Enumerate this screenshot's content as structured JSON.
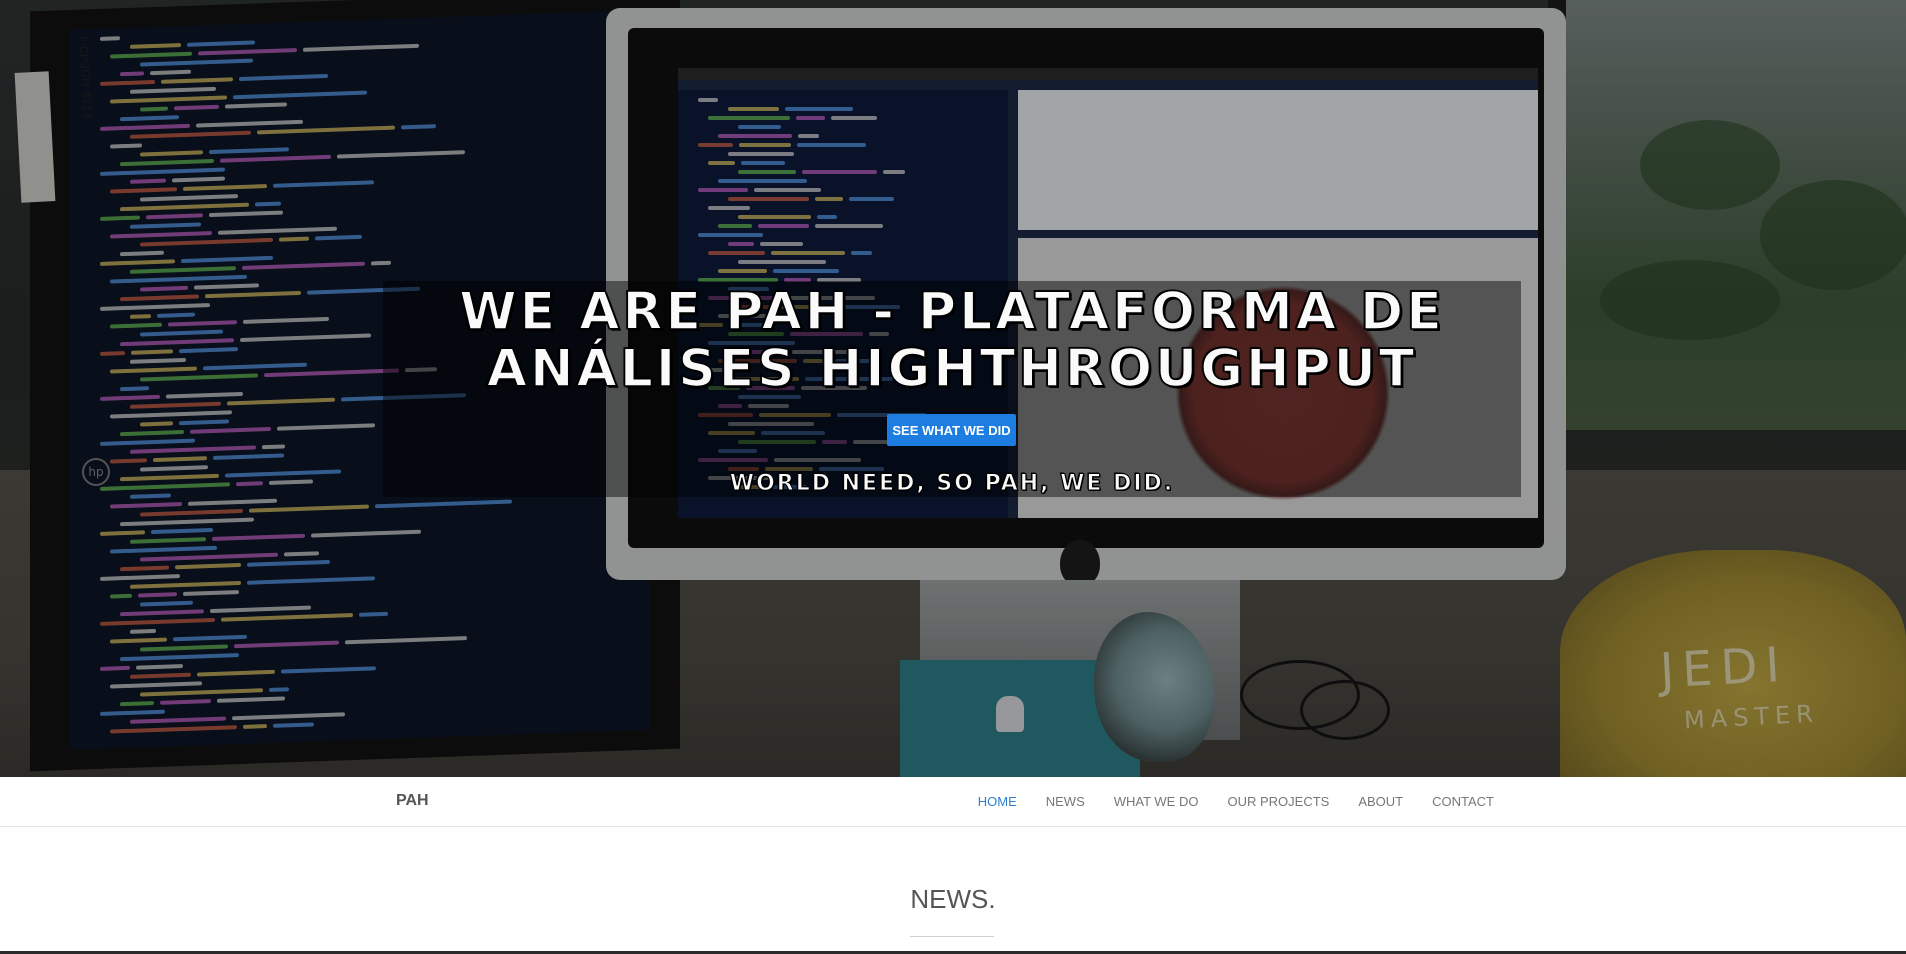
{
  "hero": {
    "title_line1": "WE ARE PAH - PLATAFORMA DE",
    "title_line2": "ANÁLISES HIGHTHROUGHPUT",
    "cta_label": "SEE WHAT WE DID",
    "tagline": "WORLD NEED, SO PAH, WE DID.",
    "background_photo": {
      "hat_text": "JEDI",
      "hat_subtext": "MASTER",
      "sticker_text": "F-CPOGM 8714"
    }
  },
  "navbar": {
    "brand": "PAH",
    "items": [
      {
        "label": "HOME",
        "active": true
      },
      {
        "label": "NEWS",
        "active": false
      },
      {
        "label": "WHAT WE DO",
        "active": false
      },
      {
        "label": "OUR PROJECTS",
        "active": false
      },
      {
        "label": "ABOUT",
        "active": false
      },
      {
        "label": "CONTACT",
        "active": false
      }
    ]
  },
  "news": {
    "heading": "NEWS."
  },
  "colors": {
    "accent": "#1d7de0",
    "active_link": "#2f7fd0",
    "nav_text": "#777777"
  }
}
